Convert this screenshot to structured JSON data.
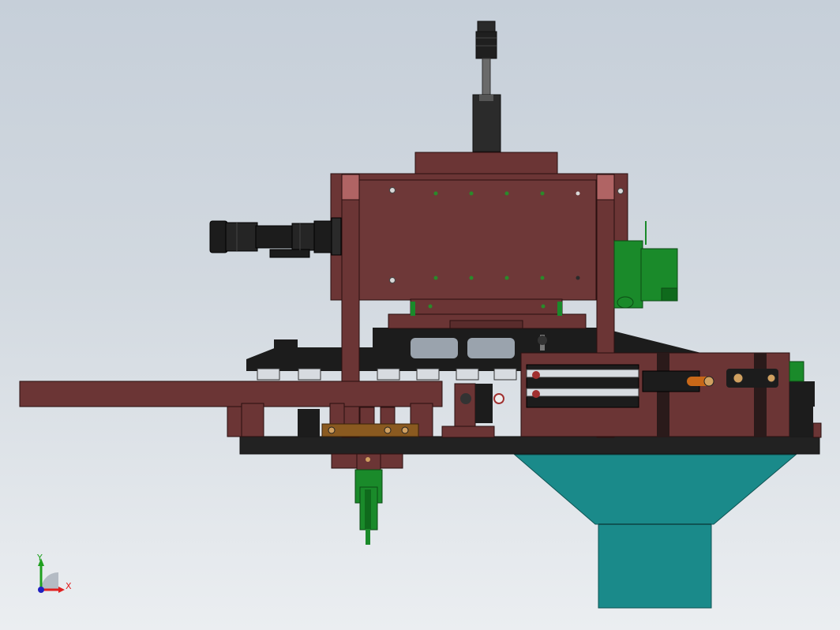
{
  "view": {
    "triad": {
      "x_label": "X",
      "y_label": "Y"
    }
  },
  "colors": {
    "background_top": "#c6cfd9",
    "background_bottom": "#ebeef1",
    "frame_plate": "#6b3535",
    "frame_plate_dark": "#5a2c2c",
    "frame_highlight": "#b06464",
    "base_plate": "#222222",
    "motor_green": "#1a8a2a",
    "funnel_teal": "#1a8a8a",
    "cylinder_black": "#1c1c1c",
    "rod_gray": "#6a6a6a",
    "brass": "#8a5a20",
    "orange_fitting": "#c86818"
  },
  "model": {
    "components": [
      "top-cylinder",
      "main-frame",
      "left-camera",
      "green-motor",
      "black-carriage",
      "horizontal-arm",
      "base-plate",
      "right-housing",
      "bottom-green-actuator",
      "teal-funnel"
    ]
  }
}
